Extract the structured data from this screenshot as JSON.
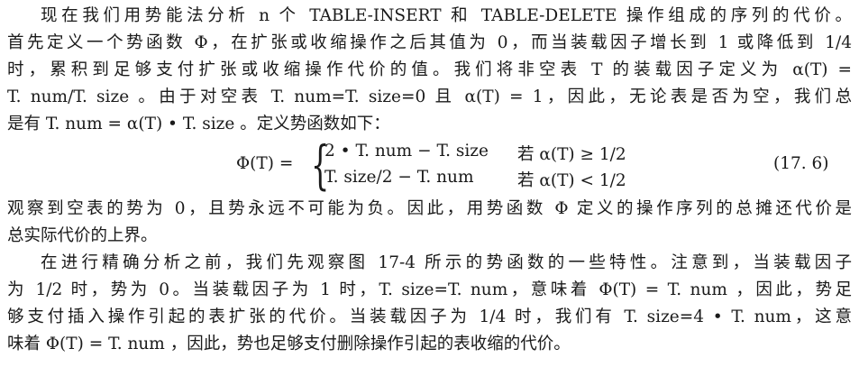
{
  "paragraph1": {
    "lines": [
      "现在我们用势能法分析 n 个 TABLE-INSERT 和 TABLE-DELETE 操作组成的序列的代价。",
      "首先定义一个势函数 Φ，在扩张或收缩操作之后其值为 0，而当装载因子增长到 1 或降低到 1/4",
      "时，累积到足够支付扩张或收缩操作代价的值。我们将非空表 T 的装载因子定义为 α(T) =",
      "T. num/T. size 。由于对空表 T. num=T. size=0 且 α(T) = 1，因此，无论表是否为空，我们总",
      "是有 T. num = α(T) • T. size 。定义势函数如下："
    ]
  },
  "equation": {
    "lhs": "Φ(T) =",
    "brace": "{",
    "case1_expr": "2 • T. num − T. size",
    "case1_cond": "若 α(T) ≥ 1/2",
    "case2_expr": "T. size/2 − T. num",
    "case2_cond": "若 α(T) < 1/2",
    "number": "(17. 6)"
  },
  "paragraph2": {
    "lines": [
      "观察到空表的势为 0，且势永远不可能为负。因此，用势函数 Φ 定义的操作序列的总摊还代价是",
      "总实际代价的上界。"
    ]
  },
  "paragraph3": {
    "lines": [
      "在进行精确分析之前，我们先观察图 17-4 所示的势函数的一些特性。注意到，当装载因子",
      "为 1/2 时，势为 0。当装载因子为 1 时，T. size=T. num，意味着 Φ(T) = T. num ，因此，势足",
      "够支付插入操作引起的表扩张的代价。当装载因子为 1/4 时，我们有 T. size=4 • T. num，这意",
      "味着 Φ(T) = T. num ，因此，势也足够支付删除操作引起的表收缩的代价。"
    ]
  }
}
